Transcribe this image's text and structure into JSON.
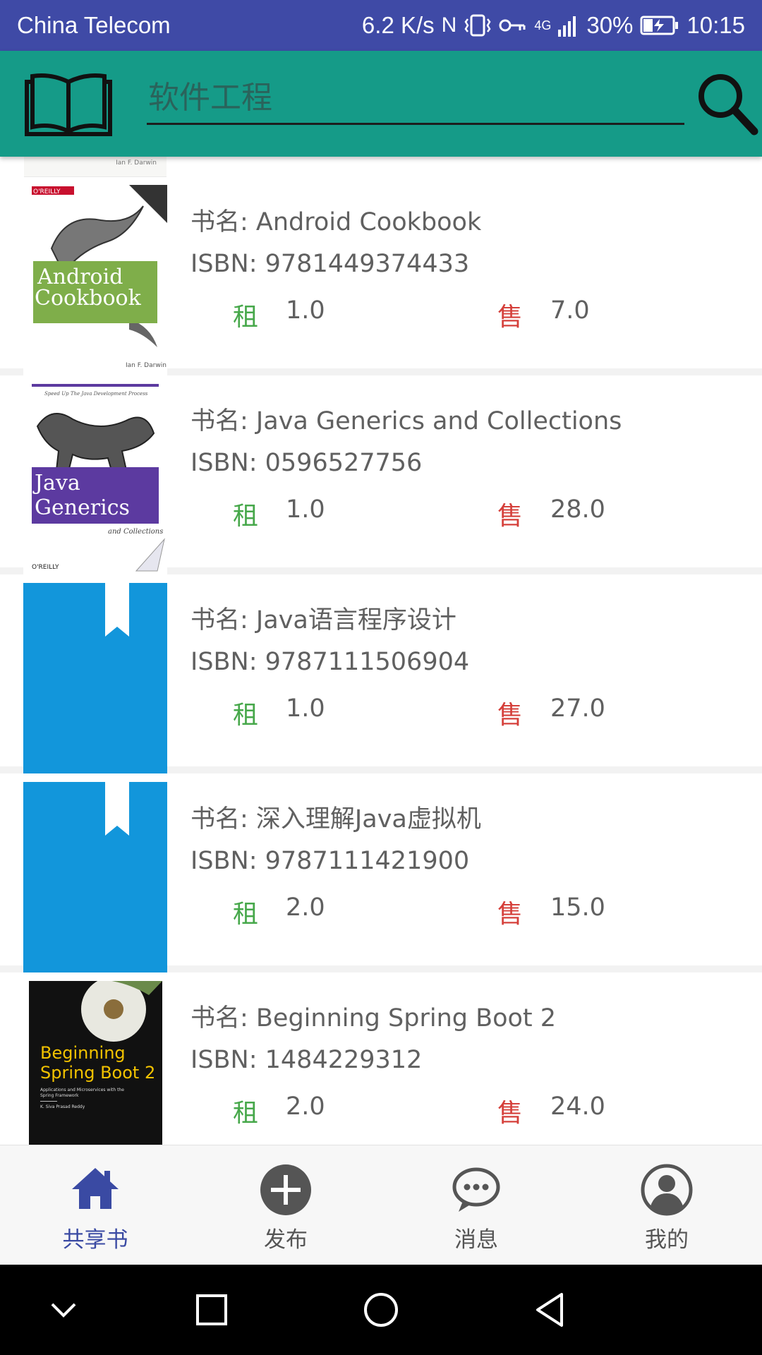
{
  "status_bar": {
    "carrier": "China Telecom",
    "network_speed": "6.2 K/s",
    "nfc_symbol": "N",
    "net_type": "4G",
    "battery": "30%",
    "time": "10:15"
  },
  "app_bar": {
    "search_placeholder": "软件工程"
  },
  "books": [
    {
      "title_label": "书名: Android Cookbook",
      "isbn_label": "ISBN: 9781449374433",
      "rent_label": "租",
      "rent_price": "1.0",
      "sale_label": "售",
      "sale_price": "7.0",
      "cover": {
        "publisher": "O'REILLY",
        "title_lines": [
          "Android",
          "Cookbook"
        ],
        "author": "Ian F. Darwin",
        "color": "#7fae4a"
      }
    },
    {
      "title_label": "书名: Java Generics and Collections",
      "isbn_label": "ISBN: 0596527756",
      "rent_label": "租",
      "rent_price": "1.0",
      "sale_label": "售",
      "sale_price": "28.0",
      "cover": {
        "publisher": "O'REILLY",
        "title_lines": [
          "Java",
          "Generics"
        ],
        "subtitle": "and Collections",
        "tagline": "Speed Up The Java Development Process",
        "color": "#5c3aa0"
      }
    },
    {
      "title_label": "书名: Java语言程序设计",
      "isbn_label": "ISBN: 9787111506904",
      "rent_label": "租",
      "rent_price": "1.0",
      "sale_label": "售",
      "sale_price": "27.0",
      "cover": {
        "placeholder": true,
        "color": "#1296db"
      }
    },
    {
      "title_label": "书名: 深入理解Java虚拟机",
      "isbn_label": "ISBN: 9787111421900",
      "rent_label": "租",
      "rent_price": "2.0",
      "sale_label": "售",
      "sale_price": "15.0",
      "cover": {
        "placeholder": true,
        "color": "#1296db"
      }
    },
    {
      "title_label": "书名: Beginning Spring Boot 2",
      "isbn_label": "ISBN: 1484229312",
      "rent_label": "租",
      "rent_price": "2.0",
      "sale_label": "售",
      "sale_price": "24.0",
      "cover": {
        "title_lines": [
          "Beginning",
          "Spring Boot 2"
        ],
        "subtitle_lines": [
          "Applications and Microservices with the",
          "Spring Framework"
        ],
        "author": "K. Siva Prasad Reddy",
        "color": "#111111"
      }
    }
  ],
  "previous_cover_author": "Ian F. Darwin",
  "bottom_nav": [
    {
      "label": "共享书",
      "icon": "home-icon",
      "active": true
    },
    {
      "label": "发布",
      "icon": "add-circle-icon",
      "active": false
    },
    {
      "label": "消息",
      "icon": "chat-bubble-icon",
      "active": false
    },
    {
      "label": "我的",
      "icon": "person-icon",
      "active": false
    }
  ],
  "colors": {
    "status_bar": "#3f4aa6",
    "app_bar": "#159b88",
    "rent": "#47a84b",
    "sale": "#d5403b",
    "nav_active": "#3a4aa3",
    "placeholder_cover": "#1296db"
  }
}
